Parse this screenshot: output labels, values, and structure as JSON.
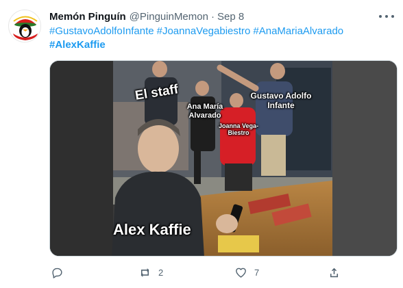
{
  "tweet": {
    "display_name": "Memón Pinguín",
    "handle": "@PinguinMemon",
    "separator": "·",
    "date": "Sep 8",
    "hashtags_line1": [
      "#GustavoAdolfoInfante",
      "#JoannaVegabiestro",
      "#AnaMariaAlvarado"
    ],
    "hashtags_line2": [
      "#AlexKaffie"
    ]
  },
  "media": {
    "captions": {
      "el_staff": "El staff",
      "ana": "Ana María Alvarado",
      "joanna": "Joanna Vega-Biestro",
      "gustavo": "Gustavo Adolfo Infante",
      "alex": "Alex Kaffie"
    }
  },
  "actions": {
    "reply_icon": "reply-icon",
    "retweet_icon": "retweet-icon",
    "retweet_count": "2",
    "like_icon": "heart-icon",
    "like_count": "7",
    "share_icon": "share-icon"
  },
  "colors": {
    "link": "#1d9bf0",
    "secondary_text": "#536471",
    "primary_text": "#0f1419"
  }
}
